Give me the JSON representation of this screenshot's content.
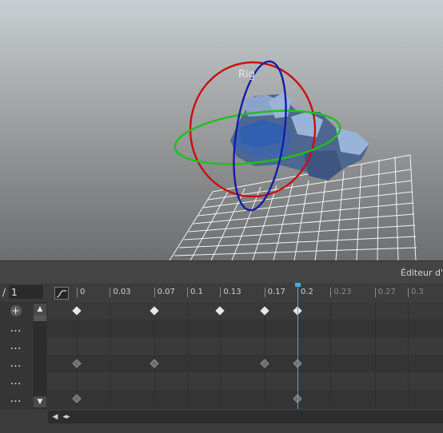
{
  "viewport": {
    "rig_label": "Rig"
  },
  "panel": {
    "title": "Éditeur d'"
  },
  "frame_field": {
    "slash": "/",
    "value": "1"
  },
  "ruler": {
    "ticks": [
      {
        "label": "0",
        "active": true
      },
      {
        "label": "0.03",
        "active": true
      },
      {
        "label": "0.07",
        "active": true
      },
      {
        "label": "0.1",
        "active": true
      },
      {
        "label": "0.13",
        "active": true
      },
      {
        "label": "0.17",
        "active": true
      },
      {
        "label": "0.2",
        "active": true
      },
      {
        "label": "0.23",
        "active": false
      },
      {
        "label": "0.27",
        "active": false
      },
      {
        "label": "0.3",
        "active": false
      }
    ],
    "playhead_time": 0.2
  },
  "left_column": {
    "rows": [
      {
        "icon": "add-track-icon",
        "glyph": "+"
      },
      {
        "icon": "more-dots-icon",
        "glyph": "…"
      },
      {
        "icon": "more-dots-icon",
        "glyph": "…"
      },
      {
        "icon": "more-dots-icon",
        "glyph": "…"
      },
      {
        "icon": "more-dots-icon",
        "glyph": "…"
      },
      {
        "icon": "more-dots-icon",
        "glyph": "…"
      }
    ]
  },
  "keyframes": {
    "tracks": [
      {
        "times": [
          0,
          0.07,
          0.13,
          0.17,
          0.2
        ],
        "style": "white"
      },
      {
        "times": [],
        "style": "gray"
      },
      {
        "times": [],
        "style": "gray"
      },
      {
        "times": [
          0,
          0.07,
          0.17,
          0.2
        ],
        "style": "gray"
      },
      {
        "times": [],
        "style": "gray"
      },
      {
        "times": [
          0,
          0.2
        ],
        "style": "gray"
      }
    ]
  },
  "colors": {
    "playhead": "#49a7e6",
    "gizmo_red": "#c81010",
    "gizmo_green": "#1cc21c",
    "gizmo_blue": "#101ea8"
  }
}
